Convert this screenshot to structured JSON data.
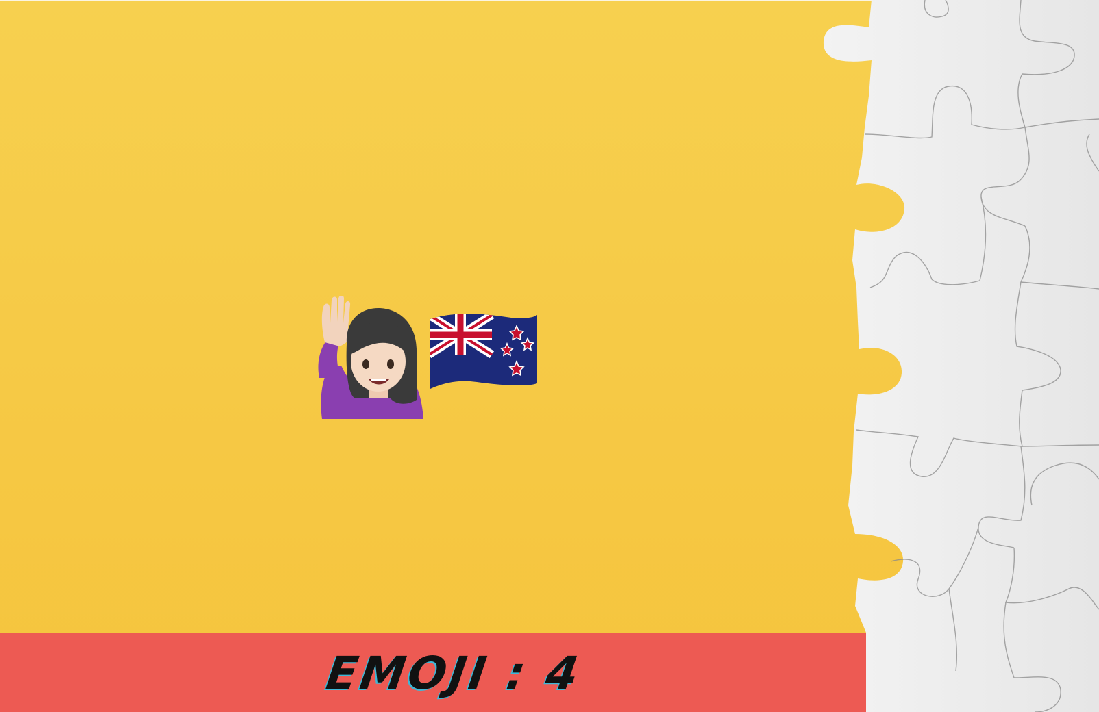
{
  "background_color": "#f6c944",
  "bar_color": "#ed5a53",
  "emojis": [
    {
      "icon": "woman-raising-hand-icon"
    },
    {
      "icon": "new-zealand-flag-icon"
    }
  ],
  "label": "EMOJI : 4"
}
